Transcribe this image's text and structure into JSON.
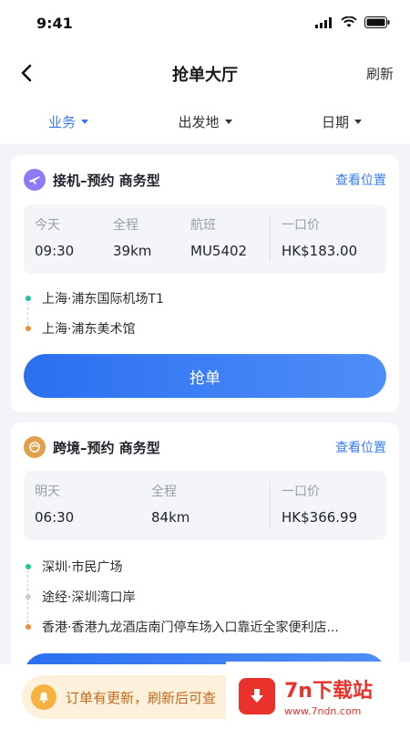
{
  "status": {
    "time": "9:41"
  },
  "nav": {
    "title": "抢单大厅",
    "refresh": "刷新"
  },
  "filters": [
    {
      "label": "业务",
      "active": true
    },
    {
      "label": "出发地",
      "active": false
    },
    {
      "label": "日期",
      "active": false
    }
  ],
  "orders": [
    {
      "type_title": "接机–预约 商务型",
      "icon": "airplane-icon",
      "view_location": "查看位置",
      "day_label": "今天",
      "time": "09:30",
      "distance_label": "全程",
      "distance": "39km",
      "flight_label": "航班",
      "flight": "MU5402",
      "price_label": "一口价",
      "price": "HK$183.00",
      "stops": [
        "上海·浦东国际机场T1",
        "上海·浦东美术馆"
      ],
      "button": "抢单"
    },
    {
      "type_title": "跨境–预约 商务型",
      "icon": "cross-border-icon",
      "view_location": "查看位置",
      "day_label": "明天",
      "time": "06:30",
      "distance_label": "全程",
      "distance": "84km",
      "price_label": "一口价",
      "price": "HK$366.99",
      "stops": [
        "深圳·市民广场",
        "途经·深圳湾口岸",
        "香港·香港九龙酒店南门停车场入口靠近全家便利店..."
      ]
    }
  ],
  "notice": {
    "text": "订单有更新，刷新后可查"
  },
  "watermark": {
    "brand": "7n下载站",
    "url": "www.7ndn.com"
  },
  "colors": {
    "accent": "#3a7cf0",
    "dot_start": "#1cc59a",
    "dot_mid": "#c9ccd2",
    "dot_end": "#f08c3a"
  }
}
